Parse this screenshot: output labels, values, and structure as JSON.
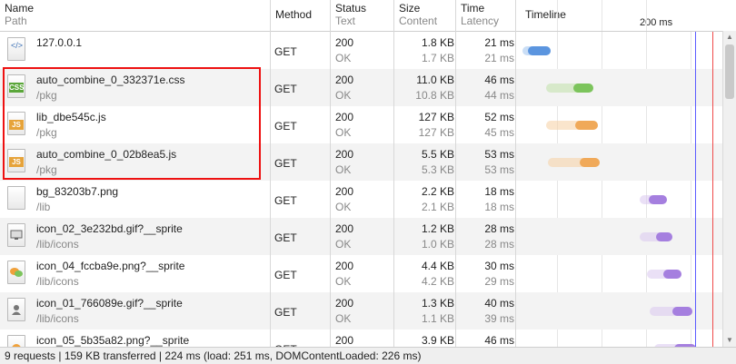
{
  "headers": {
    "name": {
      "l1": "Name",
      "l2": "Path"
    },
    "method": {
      "l1": "Method"
    },
    "status": {
      "l1": "Status",
      "l2": "Text"
    },
    "size": {
      "l1": "Size",
      "l2": "Content"
    },
    "time": {
      "l1": "Time",
      "l2": "Latency"
    },
    "timeline": {
      "l1": "Timeline",
      "scale": "200 ms"
    }
  },
  "rows": [
    {
      "name": "127.0.0.1",
      "path": "",
      "icon": "html",
      "method": "GET",
      "status": "200",
      "status_text": "OK",
      "size": "1.8 KB",
      "content": "1.7 KB",
      "time": "21 ms",
      "latency": "21 ms",
      "color": "blue"
    },
    {
      "name": "auto_combine_0_332371e.css",
      "path": "/pkg",
      "icon": "css",
      "method": "GET",
      "status": "200",
      "status_text": "OK",
      "size": "11.0 KB",
      "content": "10.8 KB",
      "time": "46 ms",
      "latency": "44 ms",
      "color": "green"
    },
    {
      "name": "lib_dbe545c.js",
      "path": "/pkg",
      "icon": "js",
      "method": "GET",
      "status": "200",
      "status_text": "OK",
      "size": "127 KB",
      "content": "127 KB",
      "time": "52 ms",
      "latency": "45 ms",
      "color": "orange"
    },
    {
      "name": "auto_combine_0_02b8ea5.js",
      "path": "/pkg",
      "icon": "js",
      "method": "GET",
      "status": "200",
      "status_text": "OK",
      "size": "5.5 KB",
      "content": "5.3 KB",
      "time": "53 ms",
      "latency": "53 ms",
      "color": "orange"
    },
    {
      "name": "bg_83203b7.png",
      "path": "/lib",
      "icon": "image",
      "method": "GET",
      "status": "200",
      "status_text": "OK",
      "size": "2.2 KB",
      "content": "2.1 KB",
      "time": "18 ms",
      "latency": "18 ms",
      "color": "purple"
    },
    {
      "name": "icon_02_3e232bd.gif?__sprite",
      "path": "/lib/icons",
      "icon": "monitor",
      "method": "GET",
      "status": "200",
      "status_text": "OK",
      "size": "1.2 KB",
      "content": "1.0 KB",
      "time": "28 ms",
      "latency": "28 ms",
      "color": "purple"
    },
    {
      "name": "icon_04_fccba9e.png?__sprite",
      "path": "/lib/icons",
      "icon": "chat",
      "method": "GET",
      "status": "200",
      "status_text": "OK",
      "size": "4.4 KB",
      "content": "4.2 KB",
      "time": "30 ms",
      "latency": "29 ms",
      "color": "purple"
    },
    {
      "name": "icon_01_766089e.gif?__sprite",
      "path": "/lib/icons",
      "icon": "user",
      "method": "GET",
      "status": "200",
      "status_text": "OK",
      "size": "1.3 KB",
      "content": "1.1 KB",
      "time": "40 ms",
      "latency": "39 ms",
      "color": "purple"
    },
    {
      "name": "icon_05_5b35a82.png?__sprite",
      "path": "",
      "icon": "orange-circle",
      "method": "GET",
      "status": "200",
      "status_text": "",
      "size": "3.9 KB",
      "content": "",
      "time": "46 ms",
      "latency": "",
      "color": "purple"
    }
  ],
  "footer": "9 requests | 159 KB transferred | 224 ms (load: 251 ms, DOMContentLoaded: 226 ms)"
}
